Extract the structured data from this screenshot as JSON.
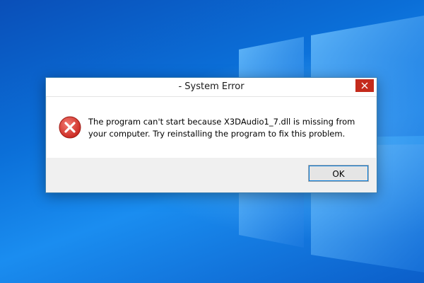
{
  "desktop": {
    "logo_icon": "windows-logo"
  },
  "dialog": {
    "title": "- System Error",
    "close_icon": "close-icon",
    "error_icon": "error-x-icon",
    "message": "The program can't start because X3DAudio1_7.dll is missing from your computer. Try reinstalling the program to fix this problem.",
    "ok_label": "OK"
  },
  "colors": {
    "close_button": "#c42b1c",
    "error_icon": "#d32f2f",
    "desktop_blue": "#0b6fd8"
  }
}
